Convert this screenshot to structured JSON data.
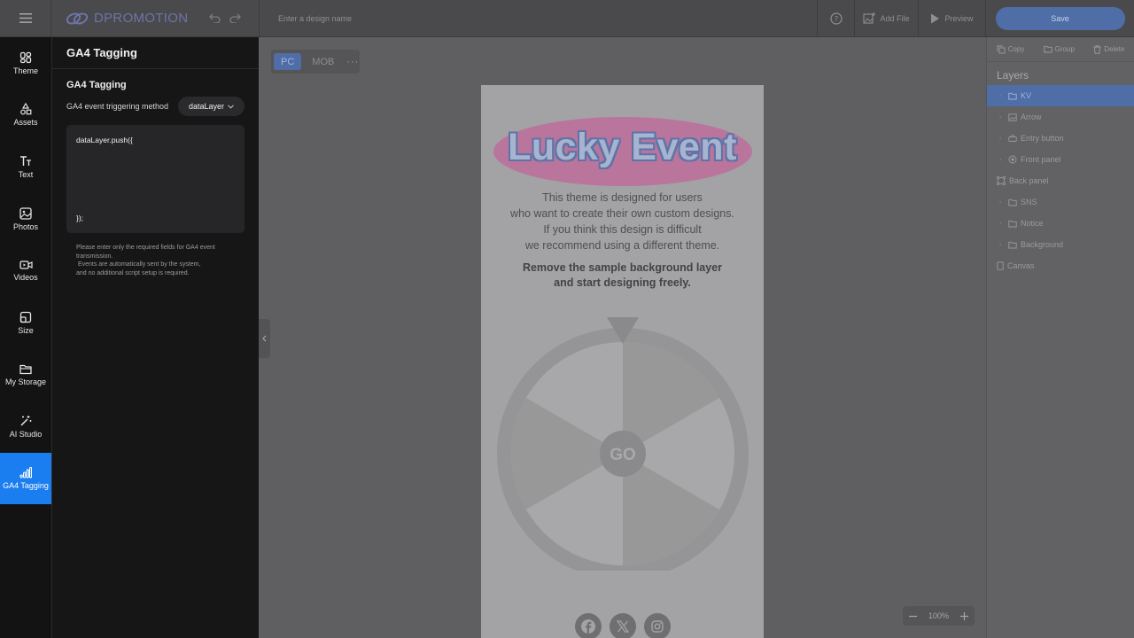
{
  "topbar": {
    "logo_text": "DPROMOTION",
    "design_name_placeholder": "Enter a design name",
    "add_file_label": "Add File",
    "preview_label": "Preview",
    "save_label": "Save"
  },
  "rail": {
    "items": [
      {
        "label": "Theme",
        "icon": "theme-icon"
      },
      {
        "label": "Assets",
        "icon": "assets-icon"
      },
      {
        "label": "Text",
        "icon": "text-icon"
      },
      {
        "label": "Photos",
        "icon": "photo-icon"
      },
      {
        "label": "Videos",
        "icon": "video-icon"
      },
      {
        "label": "Size",
        "icon": "size-icon"
      },
      {
        "label": "My Storage",
        "icon": "folder-icon"
      },
      {
        "label": "AI Studio",
        "icon": "magic-wand-icon"
      },
      {
        "label": "GA4 Tagging",
        "icon": "bar-chart-icon"
      }
    ]
  },
  "panel": {
    "title": "GA4 Tagging",
    "section_title": "GA4 Tagging",
    "method_label": "GA4 event triggering method",
    "method_value": "dataLayer",
    "code_line_1": "dataLayer.push({",
    "code_line_2": "});",
    "note_1": "Please enter only the required fields for GA4 event transmission.",
    "note_2": " Events are automatically sent by the system,",
    "note_3": "and no additional script setup is required."
  },
  "canvas": {
    "device_pc": "PC",
    "device_mob": "MOB",
    "more": "···",
    "kv_title": "Lucky Event",
    "desc_lines": [
      "This theme is designed for users",
      "who want to create their own custom designs.",
      "If you think this design is difficult",
      "we recommend using a different theme."
    ],
    "bold_lines": [
      "Remove the sample background layer",
      "and start designing freely."
    ],
    "wheel_center": "GO",
    "zoom": "100%"
  },
  "layers_panel": {
    "copy": "Copy",
    "group": "Group",
    "delete": "Delete",
    "title": "Layers",
    "items": [
      {
        "label": "KV",
        "type": "folder",
        "selected": true
      },
      {
        "label": "Arrow",
        "type": "image"
      },
      {
        "label": "Entry button",
        "type": "button"
      },
      {
        "label": "Front panel",
        "type": "component"
      },
      {
        "label": "Back panel",
        "type": "frame"
      },
      {
        "label": "SNS",
        "type": "folder"
      },
      {
        "label": "Notice",
        "type": "folder"
      },
      {
        "label": "Background",
        "type": "folder"
      },
      {
        "label": "Canvas",
        "type": "page"
      }
    ]
  },
  "colors": {
    "accent": "#1a7df0",
    "save_button": "#4f6ea8",
    "kv_ellipse": "#b9759c"
  }
}
